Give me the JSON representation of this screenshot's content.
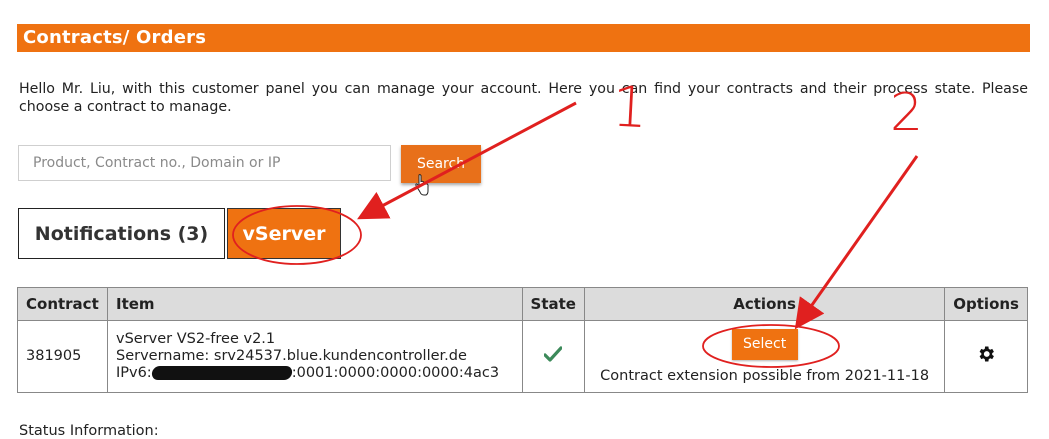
{
  "header": {
    "title": "Contracts/ Orders"
  },
  "intro": {
    "text": "Hello Mr. Liu, with this customer panel you can manage your account. Here you can find your contracts and their process state. Please choose a contract to manage."
  },
  "search": {
    "placeholder": "Product, Contract no., Domain or IP",
    "button_label": "Search"
  },
  "tabs": [
    {
      "label": "Notifications (3)",
      "active": false
    },
    {
      "label": "vServer",
      "active": true
    }
  ],
  "table": {
    "columns": [
      "Contract",
      "Item",
      "State",
      "Actions",
      "Options"
    ],
    "rows": [
      {
        "contract": "381905",
        "item_lines": [
          "vServer VS2-free v2.1",
          "Servername: srv24537.blue.kundencontroller.de",
          "IPv6:",
          ":0001:0000:0000:0000:4ac3"
        ],
        "state_icon": "checkmark-icon",
        "action_button": "Select",
        "action_note": "Contract extension possible from 2021-11-18",
        "options_icon": "gear-icon"
      }
    ]
  },
  "status": {
    "label": "Status Information:"
  },
  "annotations": {
    "label_1": "1",
    "label_2": "2"
  },
  "colors": {
    "accent": "#ef7211",
    "annotation": "#e0201f",
    "check": "#3c8a5a"
  }
}
